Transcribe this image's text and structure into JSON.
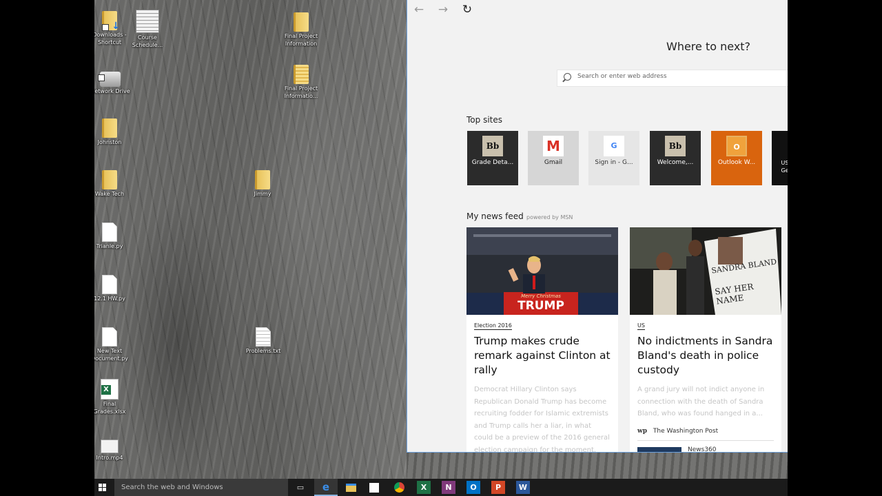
{
  "desktop": {
    "icons": [
      {
        "label": "Downloads - Shortcut",
        "kind": "folder-shortcut"
      },
      {
        "label": "Course Schedule...",
        "kind": "spreadsheet"
      },
      {
        "label": "Final Project Information",
        "kind": "folder"
      },
      {
        "label": "Network Drive",
        "kind": "network-drive"
      },
      {
        "label": "Final Project Informatio...",
        "kind": "zip-folder"
      },
      {
        "label": "Johnston",
        "kind": "folder"
      },
      {
        "label": "Wake Tech",
        "kind": "folder"
      },
      {
        "label": "Jimmy",
        "kind": "folder"
      },
      {
        "label": "Trianle.py",
        "kind": "file"
      },
      {
        "label": "12.1 HW.py",
        "kind": "file"
      },
      {
        "label": "New Text Document.py",
        "kind": "file"
      },
      {
        "label": "Problems.txt",
        "kind": "text-file"
      },
      {
        "label": "Final Grades.xlsx",
        "kind": "excel-file"
      },
      {
        "label": "Intro.mp4",
        "kind": "video-file"
      }
    ]
  },
  "browser": {
    "headline": "Where to next?",
    "address_placeholder": "Search or enter web address",
    "top_sites_label": "Top sites",
    "top_sites": [
      {
        "label": "Grade Deta...",
        "logo": "Bb",
        "bg": "#2b2b2b",
        "fg": "#ffffff"
      },
      {
        "label": "Gmail",
        "logo": "M",
        "bg": "#d6d6d6",
        "fg": "#222222"
      },
      {
        "label": "Sign in - G...",
        "logo": "G",
        "bg": "#e6e6e6",
        "fg": "#333333"
      },
      {
        "label": "Welcome,...",
        "logo": "Bb",
        "bg": "#2b2b2b",
        "fg": "#ffffff"
      },
      {
        "label": "Outlook W...",
        "logo": "O",
        "bg": "#d9640e",
        "fg": "#ffffff"
      },
      {
        "label": "US Ge",
        "logo": "",
        "bg": "#111111",
        "fg": "#ffffff"
      }
    ],
    "news_feed_label": "My news feed",
    "news_feed_sub": "powered by MSN",
    "cards": [
      {
        "category": "Election 2016",
        "title": "Trump makes crude remark against Clinton at rally",
        "summary": "Democrat Hillary Clinton says Republican Donald Trump has become recruiting fodder for Islamic extremists and Trump calls her a liar, in what could be a preview of the 2016 general election campaign for the moment.",
        "photo_caption": "TRUMP",
        "photo_banner": "Merry Christmas"
      },
      {
        "category": "US",
        "title": "No indictments in Sandra Bland's death in police custody",
        "summary": "A grand jury will not indict anyone in connection with the death of Sandra Bland, who was found hanged in a...",
        "source_logo": "wp",
        "source": "The Washington Post",
        "next_source": "News360",
        "photo_sign_line1": "SANDRA BLAND",
        "photo_sign_line2": "SAY HER NAME"
      }
    ]
  },
  "taskbar": {
    "search_placeholder": "Search the web and Windows",
    "apps": [
      "task-view",
      "edge",
      "file-explorer",
      "store",
      "chrome",
      "excel",
      "onenote",
      "outlook",
      "powerpoint",
      "word"
    ]
  },
  "colors": {
    "edge_accent": "#6ca0dc",
    "outlook_orange": "#d9640e",
    "taskbar_bg": "#1b1b1b"
  }
}
